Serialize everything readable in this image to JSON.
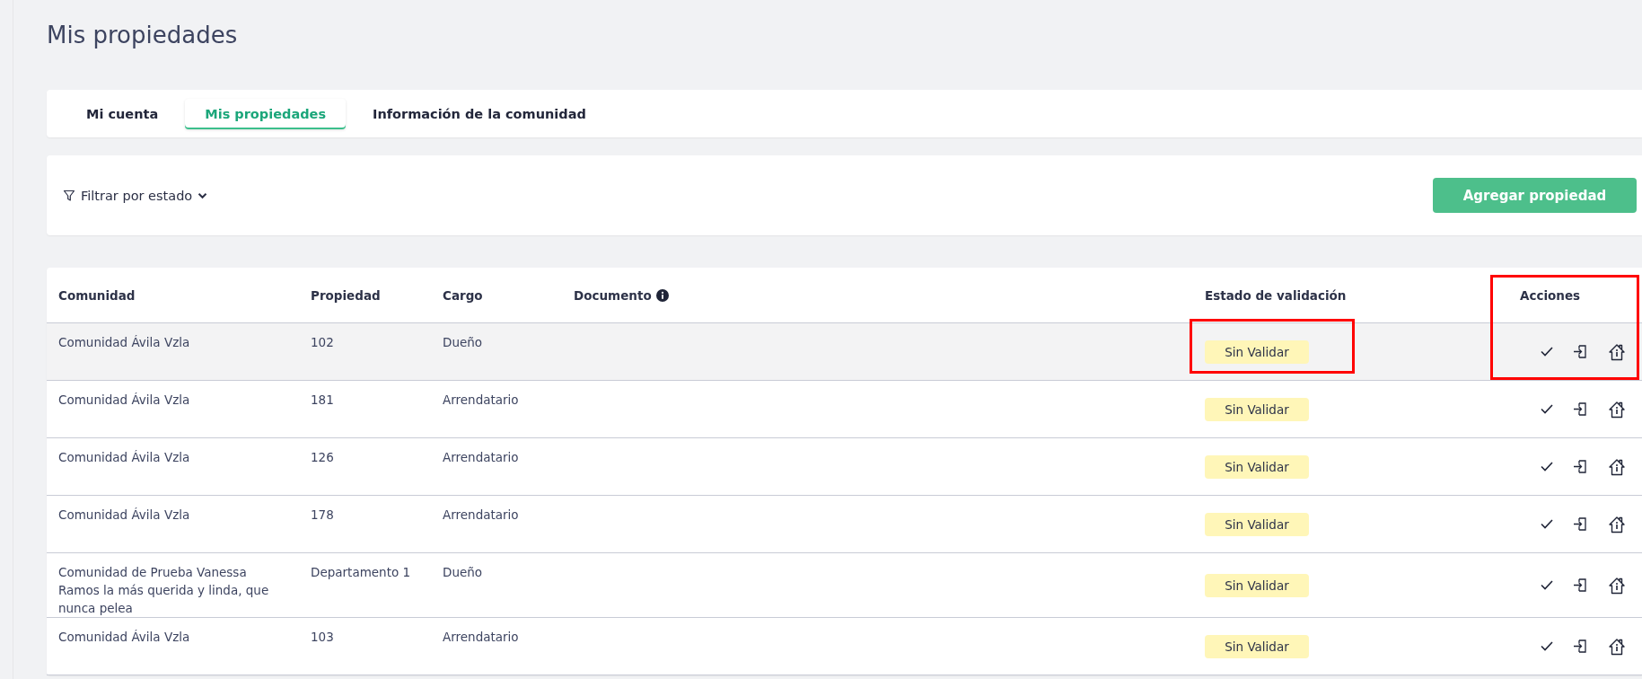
{
  "page": {
    "title": "Mis propiedades"
  },
  "tabs": [
    {
      "label": "Mi cuenta",
      "selected": false
    },
    {
      "label": "Mis propiedades",
      "selected": true
    },
    {
      "label": "Información de la comunidad",
      "selected": false
    }
  ],
  "filter": {
    "label": "Filtrar por estado"
  },
  "add_button": {
    "label": "Agregar propiedad"
  },
  "table": {
    "columns": [
      "Comunidad",
      "Propiedad",
      "Cargo",
      "Documento",
      "Estado de validación",
      "Acciones"
    ],
    "rows": [
      {
        "comunidad": "Comunidad Ávila Vzla",
        "propiedad": "102",
        "cargo": "Dueño",
        "estado": "Sin Validar",
        "hovered": true
      },
      {
        "comunidad": "Comunidad Ávila Vzla",
        "propiedad": "181",
        "cargo": "Arrendatario",
        "estado": "Sin Validar",
        "hovered": false
      },
      {
        "comunidad": "Comunidad Ávila Vzla",
        "propiedad": "126",
        "cargo": "Arrendatario",
        "estado": "Sin Validar",
        "hovered": false
      },
      {
        "comunidad": "Comunidad Ávila Vzla",
        "propiedad": "178",
        "cargo": "Arrendatario",
        "estado": "Sin Validar",
        "hovered": false
      },
      {
        "comunidad": "Comunidad de Prueba Vanessa Ramos la más querida y linda, que nunca pelea",
        "propiedad": "Departamento 1",
        "cargo": "Dueño",
        "estado": "Sin Validar",
        "hovered": false
      },
      {
        "comunidad": "Comunidad Ávila Vzla",
        "propiedad": "103",
        "cargo": "Arrendatario",
        "estado": "Sin Validar",
        "hovered": false
      }
    ],
    "annotations": {
      "status_cell_outlined": true,
      "actions_column_outlined": true
    }
  }
}
